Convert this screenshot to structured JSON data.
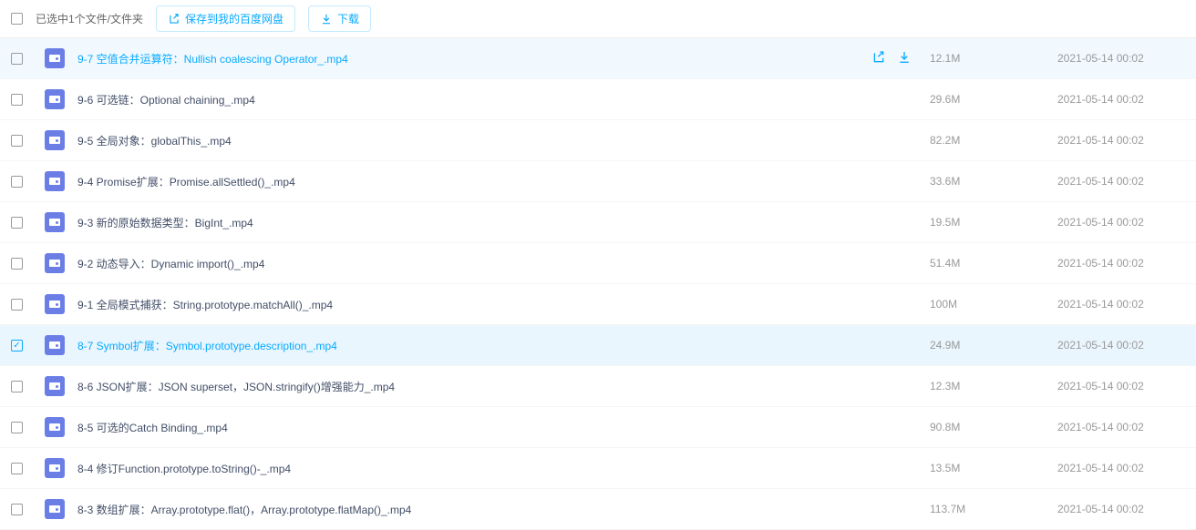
{
  "toolbar": {
    "selection_text": "已选中1个文件/文件夹",
    "save_label": "保存到我的百度网盘",
    "download_label": "下载"
  },
  "files": [
    {
      "name": "9-7 空值合并运算符：Nullish coalescing Operator_.mp4",
      "size": "12.1M",
      "date": "2021-05-14 00:02",
      "checked": false,
      "hovered": true
    },
    {
      "name": "9-6 可选链：Optional chaining_.mp4",
      "size": "29.6M",
      "date": "2021-05-14 00:02",
      "checked": false,
      "hovered": false
    },
    {
      "name": "9-5 全局对象：globalThis_.mp4",
      "size": "82.2M",
      "date": "2021-05-14 00:02",
      "checked": false,
      "hovered": false
    },
    {
      "name": "9-4 Promise扩展：Promise.allSettled()_.mp4",
      "size": "33.6M",
      "date": "2021-05-14 00:02",
      "checked": false,
      "hovered": false
    },
    {
      "name": "9-3 新的原始数据类型：BigInt_.mp4",
      "size": "19.5M",
      "date": "2021-05-14 00:02",
      "checked": false,
      "hovered": false
    },
    {
      "name": "9-2 动态导入：Dynamic import()_.mp4",
      "size": "51.4M",
      "date": "2021-05-14 00:02",
      "checked": false,
      "hovered": false
    },
    {
      "name": "9-1 全局模式捕获：String.prototype.matchAll()_.mp4",
      "size": "100M",
      "date": "2021-05-14 00:02",
      "checked": false,
      "hovered": false
    },
    {
      "name": "8-7 Symbol扩展：Symbol.prototype.description_.mp4",
      "size": "24.9M",
      "date": "2021-05-14 00:02",
      "checked": true,
      "hovered": false
    },
    {
      "name": "8-6 JSON扩展：JSON superset，JSON.stringify()增强能力_.mp4",
      "size": "12.3M",
      "date": "2021-05-14 00:02",
      "checked": false,
      "hovered": false
    },
    {
      "name": "8-5 可选的Catch Binding_.mp4",
      "size": "90.8M",
      "date": "2021-05-14 00:02",
      "checked": false,
      "hovered": false
    },
    {
      "name": "8-4 修订Function.prototype.toString()-_.mp4",
      "size": "13.5M",
      "date": "2021-05-14 00:02",
      "checked": false,
      "hovered": false
    },
    {
      "name": "8-3 数组扩展：Array.prototype.flat()，Array.prototype.flatMap()_.mp4",
      "size": "113.7M",
      "date": "2021-05-14 00:02",
      "checked": false,
      "hovered": false
    }
  ]
}
